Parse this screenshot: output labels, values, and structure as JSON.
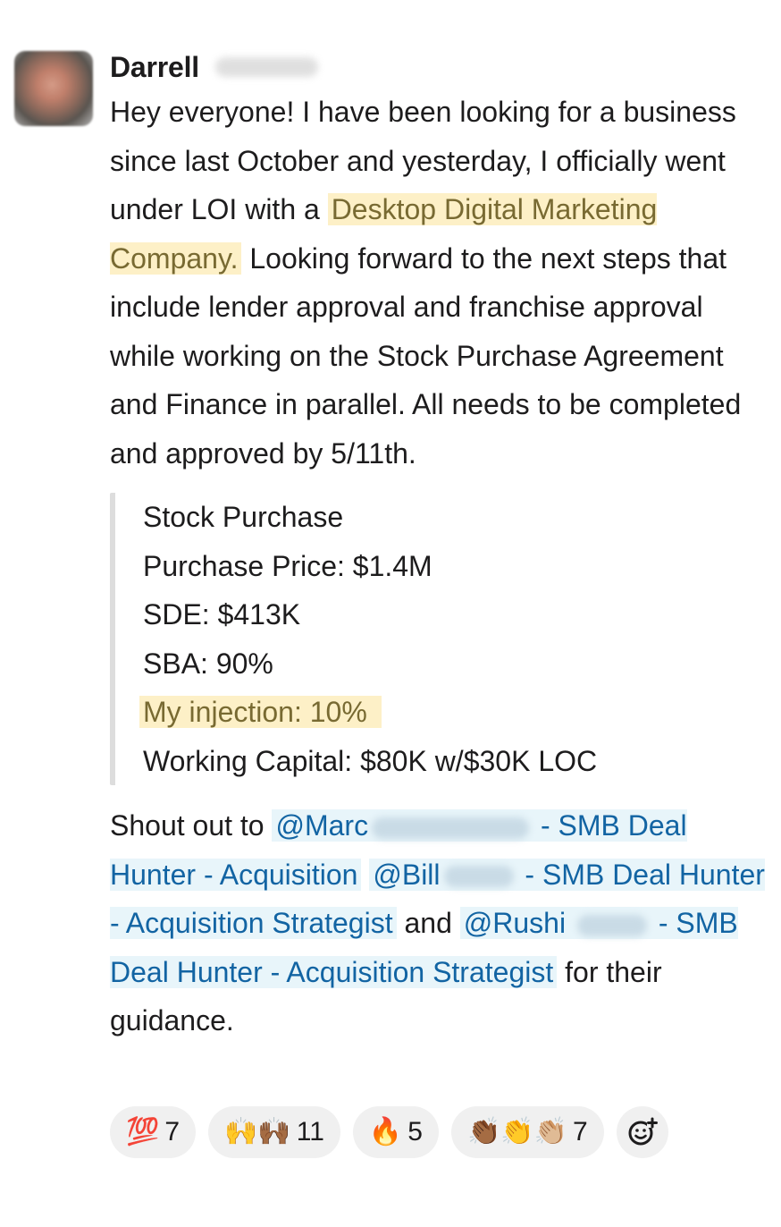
{
  "message": {
    "sender": "Darrell",
    "body": {
      "p1_before": "Hey everyone! I have been looking for a business since last October and yesterday, I officially went under LOI with a ",
      "p1_highlight": "Desktop Digital Marketing Company.",
      "p1_after": " Looking forward to the next steps that include lender approval and franchise approval while working on the Stock Purchase Agreement and Finance in parallel. All needs to be completed and approved by 5/11th."
    },
    "quote": {
      "line1": "Stock Purchase",
      "line2": "Purchase Price: $1.4M",
      "line3": "SDE: $413K",
      "line4": "SBA: 90%",
      "line5": "My injection: 10%",
      "line6": "Working Capital: $80K w/$30K LOC"
    },
    "shoutout": {
      "prefix": "Shout out to ",
      "mention1_name": "@Marc",
      "mention1_title": " - SMB Deal Hunter - Acquisition",
      "mention2_name": "@Bill",
      "mention2_title": " - SMB Deal Hunter - Acquisition Strategist",
      "and": " and ",
      "mention3_name": "@Rushi",
      "mention3_title": " - SMB Deal Hunter - Acquisition Strategist",
      "suffix": " for their guidance."
    }
  },
  "reactions": [
    {
      "emoji": "💯",
      "count": "7"
    },
    {
      "emoji": "🙌🙌🏾",
      "count": "11"
    },
    {
      "emoji": "🔥",
      "count": "5"
    },
    {
      "emoji": "👏🏾👏👏🏼",
      "count": "7"
    }
  ],
  "icons": {
    "add_reaction": "add-reaction-icon"
  }
}
